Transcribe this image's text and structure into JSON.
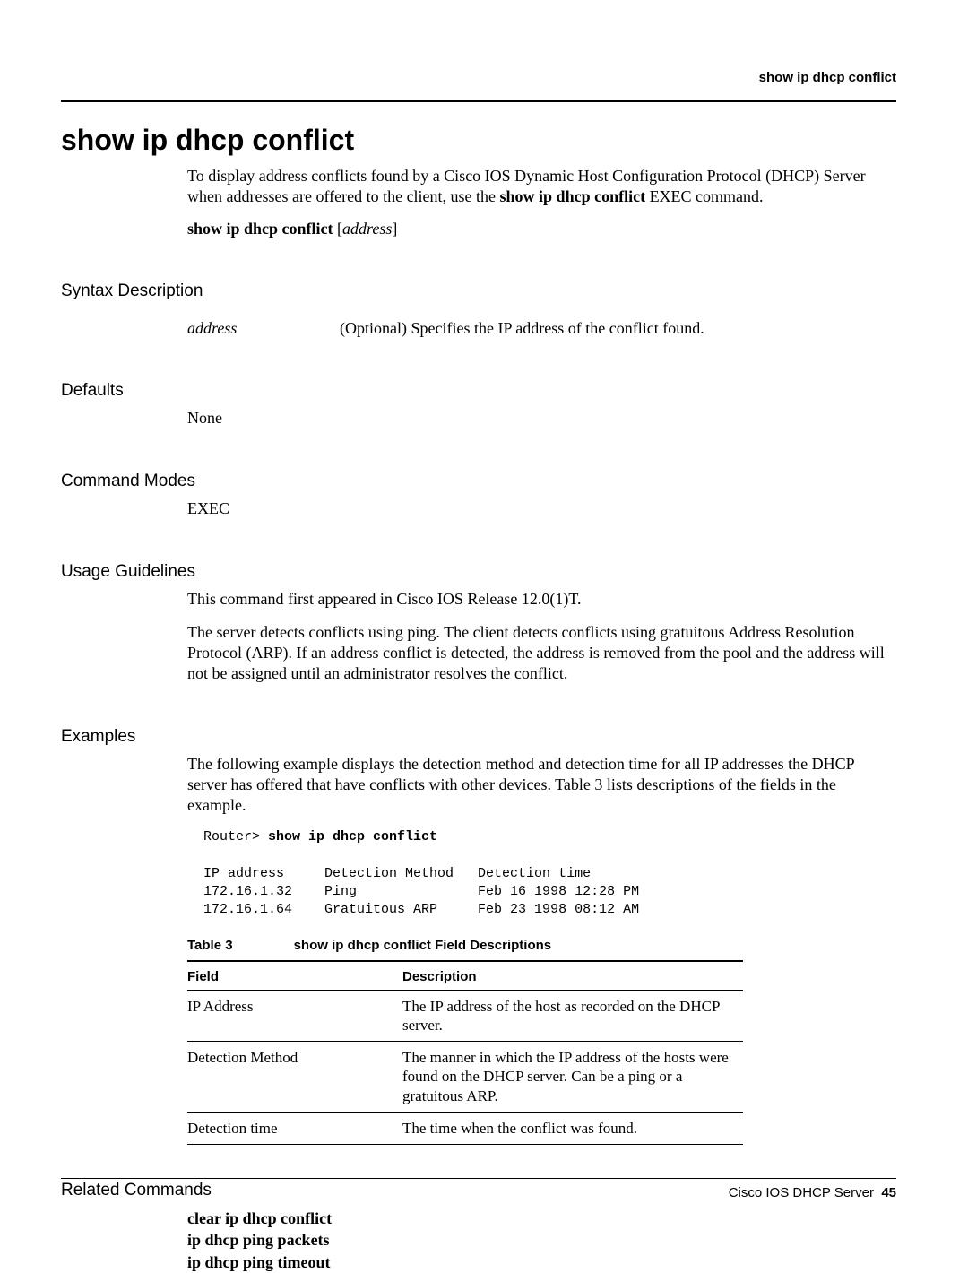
{
  "running_head": "show ip dhcp conflict",
  "title": "show ip dhcp conflict",
  "intro_para_html": "To display address conflicts found by a Cisco IOS Dynamic Host Configuration Protocol (DHCP) Server when addresses are offered to the client, use the <b>show ip dhcp conflict</b> EXEC command.",
  "syntax_line_bold": "show ip dhcp conflict",
  "syntax_line_arg": "address",
  "sections": {
    "syntax_desc": {
      "heading": "Syntax Description",
      "arg": "address",
      "arg_desc": "(Optional) Specifies the IP address of the conflict found."
    },
    "defaults": {
      "heading": "Defaults",
      "text": "None"
    },
    "command_modes": {
      "heading": "Command Modes",
      "text": "EXEC"
    },
    "usage": {
      "heading": "Usage Guidelines",
      "p1": "This command first appeared in Cisco IOS Release 12.0(1)T.",
      "p2": "The server detects conflicts using ping. The client detects conflicts using gratuitous Address Resolution Protocol (ARP). If an address conflict is detected, the address is removed from the pool and the address will not be assigned until an administrator resolves the conflict."
    },
    "examples": {
      "heading": "Examples",
      "intro": "The following example displays the detection method and detection time for all IP addresses the DHCP server has offered that have conflicts with other devices. Table 3 lists descriptions of the fields in the example.",
      "code_prompt": "Router> ",
      "code_cmd": "show ip dhcp conflict",
      "code_header": "IP address     Detection Method   Detection time",
      "code_row1": "172.16.1.32    Ping               Feb 16 1998 12:28 PM",
      "code_row2": "172.16.1.64    Gratuitous ARP     Feb 23 1998 08:12 AM",
      "table_label": "Table 3",
      "table_title": "show ip dhcp conflict Field Descriptions",
      "table_head_field": "Field",
      "table_head_desc": "Description",
      "rows": [
        {
          "field": "IP Address",
          "desc": "The IP address of the host as recorded on the DHCP server."
        },
        {
          "field": "Detection Method",
          "desc": "The manner in which the IP address of the hosts were found on the DHCP server. Can be a ping or a gratuitous ARP."
        },
        {
          "field": "Detection time",
          "desc": "The time when the conflict was found."
        }
      ]
    },
    "related": {
      "heading": "Related Commands",
      "items": [
        "clear ip dhcp conflict",
        "ip dhcp ping packets",
        "ip dhcp ping timeout"
      ]
    }
  },
  "footer": {
    "text": "Cisco IOS DHCP Server",
    "page": "45"
  }
}
